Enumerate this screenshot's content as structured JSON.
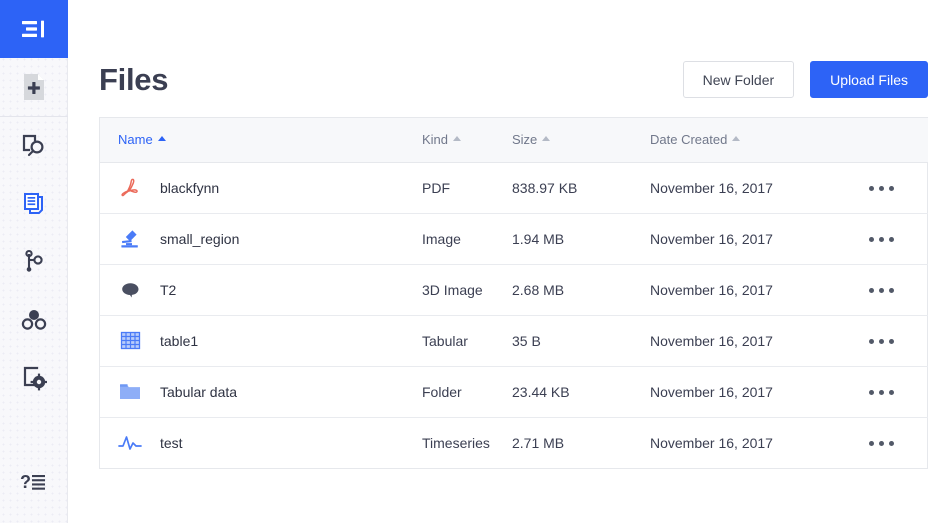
{
  "sidebar": {
    "items": [
      {
        "name": "sidebar-item-overview",
        "icon": "panel-menu-icon",
        "state": "active-fill"
      },
      {
        "name": "sidebar-item-new-file",
        "icon": "new-file-plus-icon",
        "state": "default"
      },
      {
        "name": "sidebar-item-discover",
        "icon": "search-panel-icon",
        "state": "default"
      },
      {
        "name": "sidebar-item-files",
        "icon": "documents-stack-icon",
        "state": "selected"
      },
      {
        "name": "sidebar-item-graph",
        "icon": "graph-nodes-icon",
        "state": "default"
      },
      {
        "name": "sidebar-item-models",
        "icon": "three-circles-icon",
        "state": "default"
      },
      {
        "name": "sidebar-item-settings",
        "icon": "frame-gear-icon",
        "state": "default"
      },
      {
        "name": "sidebar-item-help",
        "icon": "question-list-icon",
        "state": "default"
      }
    ]
  },
  "header": {
    "title": "Files",
    "new_folder_label": "New Folder",
    "upload_files_label": "Upload Files"
  },
  "table": {
    "columns": [
      {
        "label": "Name",
        "sort": "asc",
        "active": true
      },
      {
        "label": "Kind",
        "sort": "asc",
        "active": false
      },
      {
        "label": "Size",
        "sort": "asc",
        "active": false
      },
      {
        "label": "Date Created",
        "sort": "asc",
        "active": false
      }
    ],
    "rows": [
      {
        "icon": "pdf-file-icon",
        "name": "blackfynn",
        "kind": "PDF",
        "size": "838.97 KB",
        "date": "November 16, 2017",
        "menu": "row-actions-menu"
      },
      {
        "icon": "microscope-icon",
        "name": "small_region",
        "kind": "Image",
        "size": "1.94 MB",
        "date": "November 16, 2017",
        "menu": "row-actions-menu"
      },
      {
        "icon": "brain-icon",
        "name": "T2",
        "kind": "3D Image",
        "size": "2.68 MB",
        "date": "November 16, 2017",
        "menu": "row-actions-menu"
      },
      {
        "icon": "table-grid-icon",
        "name": "table1",
        "kind": "Tabular",
        "size": "35 B",
        "date": "November 16, 2017",
        "menu": "row-actions-menu"
      },
      {
        "icon": "folder-icon",
        "name": "Tabular data",
        "kind": "Folder",
        "size": "23.44 KB",
        "date": "November 16, 2017",
        "menu": "row-actions-menu"
      },
      {
        "icon": "timeseries-wave-icon",
        "name": "test",
        "kind": "Timeseries",
        "size": "2.71 MB",
        "date": "November 16, 2017",
        "menu": "row-actions-menu"
      }
    ]
  },
  "colors": {
    "accent_blue": "#2d63f6",
    "pdf_red": "#eb6a5a",
    "folder_blue": "#8eaef7",
    "brain_gray": "#4a4f61",
    "text_dark": "#3b3f52",
    "text_muted": "#71788b",
    "sidebar_bg": "#f8f8fb",
    "table_header_bg": "#f7f8fa",
    "border": "#e6e8ec"
  }
}
